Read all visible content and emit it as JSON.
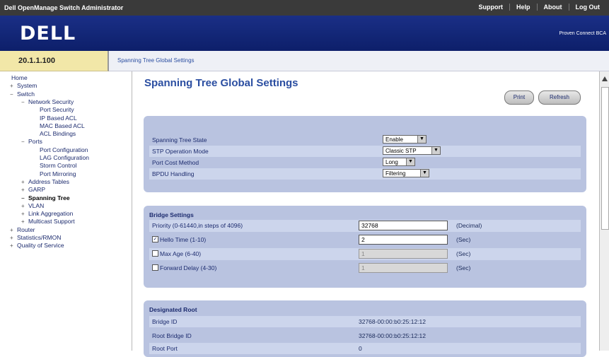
{
  "app_title": "Dell OpenManage Switch Administrator",
  "top_links": [
    "Support",
    "Help",
    "About",
    "Log Out"
  ],
  "logo": "DELL",
  "tagline": "Proven Connect BCA",
  "ip": "20.1.1.100",
  "breadcrumb": "Spanning Tree Global Settings",
  "tree": [
    {
      "label": "Home",
      "tog": "",
      "indent": 0
    },
    {
      "label": "System",
      "tog": "+",
      "indent": 1
    },
    {
      "label": "Switch",
      "tog": "-",
      "indent": 1
    },
    {
      "label": "Network Security",
      "tog": "-",
      "indent": 2
    },
    {
      "label": "Port Security",
      "tog": "",
      "indent": 3
    },
    {
      "label": "IP Based ACL",
      "tog": "",
      "indent": 3
    },
    {
      "label": "MAC Based ACL",
      "tog": "",
      "indent": 3
    },
    {
      "label": "ACL Bindings",
      "tog": "",
      "indent": 3
    },
    {
      "label": "Ports",
      "tog": "-",
      "indent": 2
    },
    {
      "label": "Port Configuration",
      "tog": "",
      "indent": 3
    },
    {
      "label": "LAG Configuration",
      "tog": "",
      "indent": 3
    },
    {
      "label": "Storm Control",
      "tog": "",
      "indent": 3
    },
    {
      "label": "Port Mirroring",
      "tog": "",
      "indent": 3
    },
    {
      "label": "Address Tables",
      "tog": "+",
      "indent": 2
    },
    {
      "label": "GARP",
      "tog": "+",
      "indent": 2
    },
    {
      "label": "Spanning Tree",
      "tog": "-",
      "indent": 2,
      "selected": true
    },
    {
      "label": "VLAN",
      "tog": "+",
      "indent": 2
    },
    {
      "label": "Link Aggregation",
      "tog": "+",
      "indent": 2
    },
    {
      "label": "Multicast Support",
      "tog": "+",
      "indent": 2
    },
    {
      "label": "Router",
      "tog": "+",
      "indent": 1
    },
    {
      "label": "Statistics/RMON",
      "tog": "+",
      "indent": 1
    },
    {
      "label": "Quality of Service",
      "tog": "+",
      "indent": 1
    }
  ],
  "page_title": "Spanning Tree Global Settings",
  "buttons": {
    "print": "Print",
    "refresh": "Refresh"
  },
  "global": {
    "rows": [
      {
        "label": "Spanning Tree State",
        "value": "Enable"
      },
      {
        "label": "STP Operation Mode",
        "value": "Classic STP"
      },
      {
        "label": "Port Cost Method",
        "value": "Long"
      },
      {
        "label": "BPDU Handling",
        "value": "Filtering"
      }
    ]
  },
  "bridge": {
    "heading": "Bridge Settings",
    "priority": {
      "label": "Priority (0-61440,in steps of 4096)",
      "value": "32768",
      "unit": "(Decimal)"
    },
    "hello": {
      "label": "Hello Time (1-10)",
      "value": "2",
      "unit": "(Sec)",
      "checked": true
    },
    "max_age": {
      "label": "Max Age (6-40)",
      "value": "1",
      "unit": "(Sec)",
      "checked": false
    },
    "fwd_delay": {
      "label": "Forward Delay (4-30)",
      "value": "1",
      "unit": "(Sec)",
      "checked": false
    }
  },
  "root": {
    "heading": "Designated Root",
    "rows": [
      {
        "label": "Bridge ID",
        "value": "32768-00:00:b0:25:12:12"
      },
      {
        "label": "Root Bridge ID",
        "value": "32768-00:00:b0:25:12:12"
      },
      {
        "label": "Root Port",
        "value": "0"
      }
    ]
  }
}
